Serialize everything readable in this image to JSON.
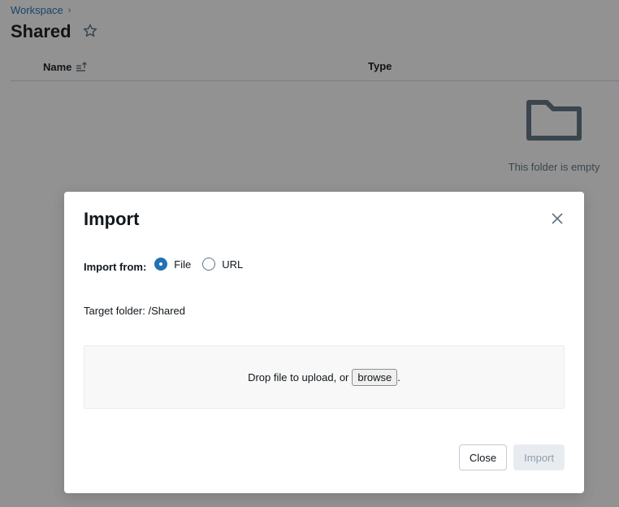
{
  "breadcrumb": {
    "items": [
      "Workspace"
    ],
    "separator": "›"
  },
  "page": {
    "title": "Shared",
    "favorite_icon": "star-outline-icon"
  },
  "table": {
    "columns": [
      {
        "label": "Name",
        "sort_icon": "sort-ascending-icon"
      },
      {
        "label": "Type"
      }
    ],
    "rows": []
  },
  "empty_state": {
    "icon": "folder-icon",
    "text": "This folder is empty"
  },
  "modal": {
    "title": "Import",
    "close_icon": "close-icon",
    "import_from_label": "Import from:",
    "options": [
      {
        "label": "File",
        "checked": true
      },
      {
        "label": "URL",
        "checked": false
      }
    ],
    "target_folder": "Target folder: /Shared",
    "dropzone": {
      "text": "Drop file to upload, or",
      "browse_label": "browse",
      "suffix": "."
    },
    "buttons": {
      "close_label": "Close",
      "import_label": "Import",
      "import_disabled": true
    },
    "colors": {
      "accent": "#2272b4",
      "disabled_bg": "#e8ecf0",
      "disabled_text": "#8e9eab"
    }
  }
}
